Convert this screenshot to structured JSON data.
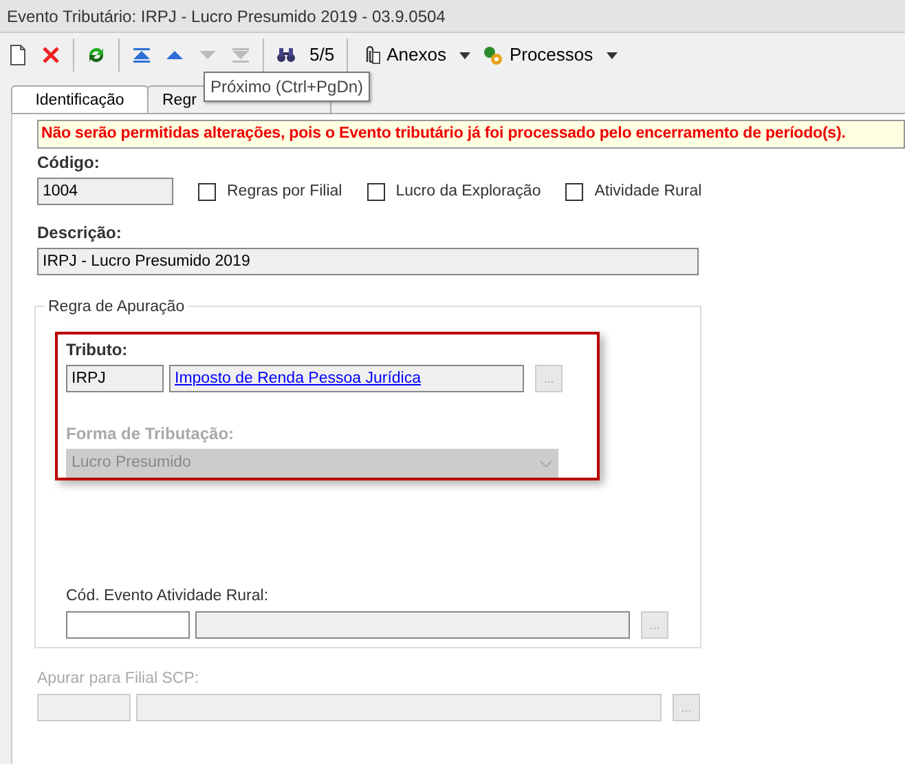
{
  "window": {
    "title": "Evento Tributário: IRPJ - Lucro Presumido 2019 - 03.9.0504"
  },
  "toolbar": {
    "buttons": [
      {
        "kind": "new",
        "disabled": false
      },
      {
        "kind": "delete",
        "disabled": false
      },
      {
        "kind": "sep"
      },
      {
        "kind": "refresh",
        "disabled": false
      },
      {
        "kind": "sep"
      },
      {
        "kind": "first",
        "disabled": false
      },
      {
        "kind": "prev",
        "disabled": false
      },
      {
        "kind": "next",
        "disabled": true
      },
      {
        "kind": "last",
        "disabled": true
      },
      {
        "kind": "sep"
      },
      {
        "kind": "find",
        "disabled": false
      }
    ],
    "counter": "5/5",
    "menus": [
      {
        "kind": "attach",
        "label": "Anexos"
      },
      {
        "kind": "process",
        "label": "Processos"
      }
    ]
  },
  "tooltip": "Próximo (Ctrl+PgDn)",
  "tabs": [
    {
      "label": "Identificação",
      "selected": true
    },
    {
      "label": "Regr",
      "selected": false
    }
  ],
  "warning": "Não serão permitidas alterações, pois o Evento tributário já foi processado pelo encerramento de período(s).",
  "codigo": {
    "label": "Código:",
    "value": "1004"
  },
  "checkboxes": [
    {
      "label": "Regras por Filial",
      "checked": false
    },
    {
      "label": "Lucro da Exploração",
      "checked": false
    },
    {
      "label": "Atividade Rural",
      "checked": false
    }
  ],
  "descricao": {
    "label": "Descrição:",
    "value": "IRPJ - Lucro Presumido 2019"
  },
  "regra": {
    "legend": "Regra de Apuração",
    "tributo": {
      "label": "Tributo:",
      "code": "IRPJ",
      "name": "Imposto de Renda Pessoa Jurídica",
      "button": "..."
    },
    "forma": {
      "label": "Forma de Tributação:",
      "value": "Lucro Presumido",
      "disabled": true
    },
    "cod_evento": {
      "label": "Cód. Evento Atividade Rural:",
      "button": "...",
      "disabled": false
    }
  },
  "apurar": {
    "label": "Apurar para Filial SCP:",
    "button": "...",
    "disabled": true
  }
}
